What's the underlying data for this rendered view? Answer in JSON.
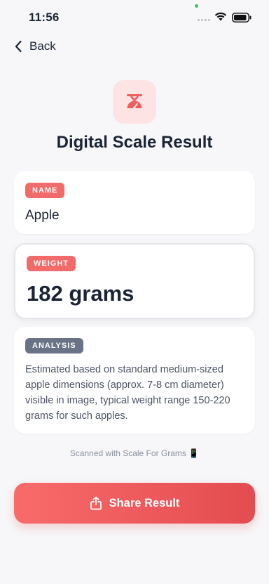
{
  "status_bar": {
    "time": "11:56"
  },
  "nav": {
    "back_label": "Back"
  },
  "header": {
    "title": "Digital Scale Result",
    "icon": "scale-icon"
  },
  "cards": {
    "name": {
      "label": "NAME",
      "value": "Apple"
    },
    "weight": {
      "label": "WEIGHT",
      "value": "182 grams"
    },
    "analysis": {
      "label": "ANALYSIS",
      "text": "Estimated based on standard medium-sized apple dimensions (approx. 7-8 cm diameter) visible in image, typical weight range 150-220 grams for such apples."
    }
  },
  "footer": {
    "note": "Scanned with Scale For Grams 📱"
  },
  "share_button": {
    "label": "Share Result",
    "icon": "share-icon"
  },
  "colors": {
    "accent": "#f26b6b",
    "badge_grey": "#697286",
    "text_dark": "#1b2434"
  }
}
